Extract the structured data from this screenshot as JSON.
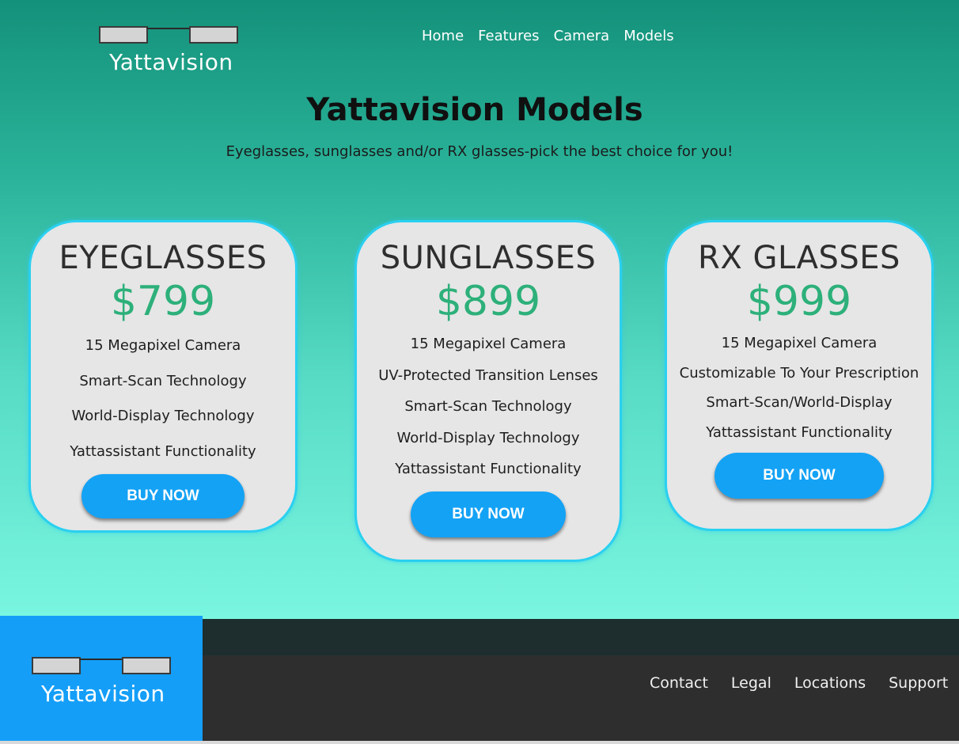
{
  "brand": {
    "name": "Yattavision"
  },
  "nav": {
    "items": [
      "Home",
      "Features",
      "Camera",
      "Models"
    ]
  },
  "hero": {
    "title": "Yattavision Models",
    "subtitle": "Eyeglasses, sunglasses and/or RX glasses-pick the best choice for you!"
  },
  "models": [
    {
      "title": "EYEGLASSES",
      "price": "$799",
      "features": [
        "15 Megapixel Camera",
        "Smart-Scan Technology",
        "World-Display Technology",
        "Yattassistant Functionality"
      ],
      "cta": "BUY NOW"
    },
    {
      "title": "SUNGLASSES",
      "price": "$899",
      "features": [
        "15 Megapixel Camera",
        "UV-Protected Transition Lenses",
        "Smart-Scan Technology",
        "World-Display Technology",
        "Yattassistant Functionality"
      ],
      "cta": "BUY NOW"
    },
    {
      "title": "RX GLASSES",
      "price": "$999",
      "features": [
        "15 Megapixel Camera",
        "Customizable To Your Prescription",
        "Smart-Scan/World-Display",
        "Yattassistant Functionality"
      ],
      "cta": "BUY NOW"
    }
  ],
  "footer": {
    "brand": "Yattavision",
    "links": [
      "Contact",
      "Legal",
      "Locations",
      "Support"
    ]
  },
  "colors": {
    "accent_blue": "#14a2f5",
    "price_green": "#2db07a",
    "card_border": "#2ad0f0",
    "footer_dark": "#2e2e2e"
  }
}
